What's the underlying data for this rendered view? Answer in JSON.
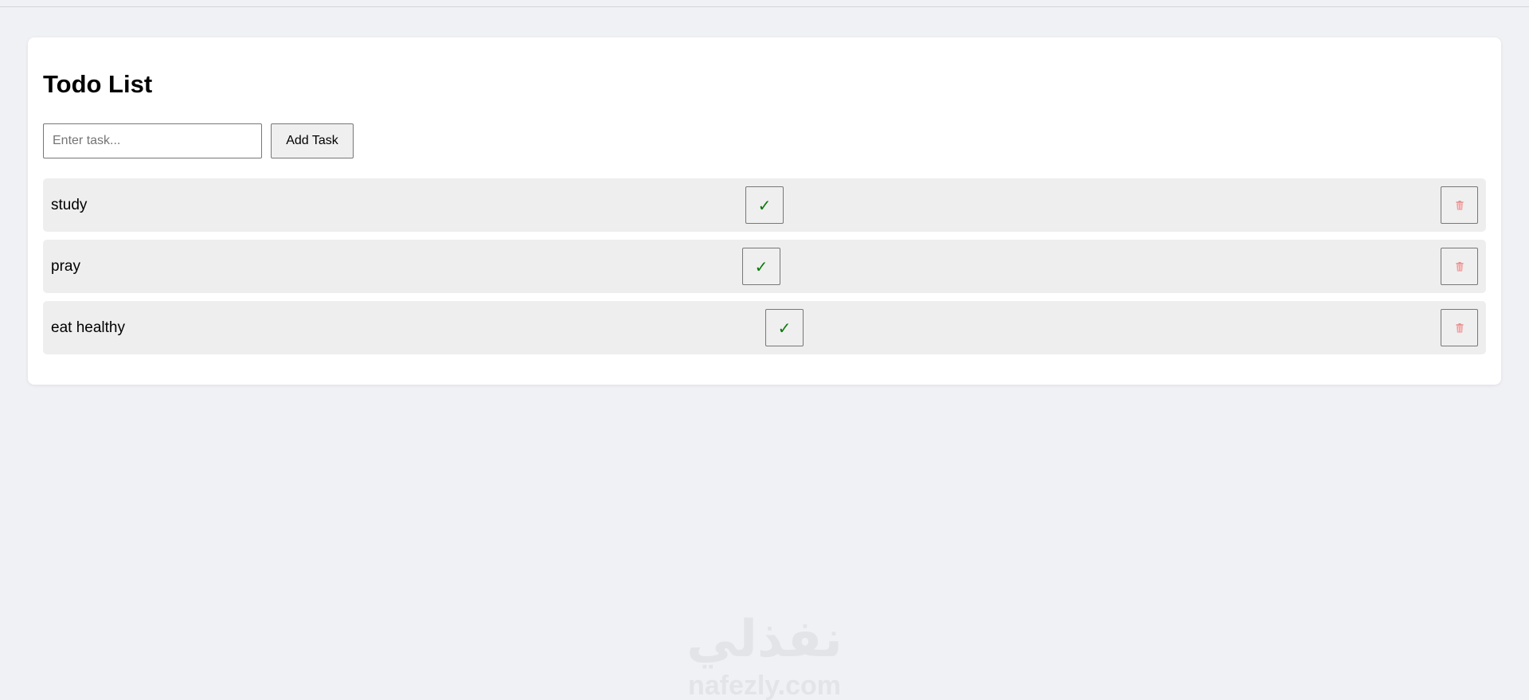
{
  "app": {
    "title": "Todo List"
  },
  "input": {
    "placeholder": "Enter task...",
    "value": ""
  },
  "add_button": {
    "label": "Add Task"
  },
  "tasks": [
    {
      "text": "study",
      "done_icon": "checkmark-icon",
      "delete_icon": "trash-icon"
    },
    {
      "text": "pray",
      "done_icon": "checkmark-icon",
      "delete_icon": "trash-icon"
    },
    {
      "text": "eat healthy",
      "done_icon": "checkmark-icon",
      "delete_icon": "trash-icon"
    }
  ],
  "icons": {
    "check_glyph": "✓"
  },
  "colors": {
    "page_background": "#f0f1f5",
    "card_background": "#ffffff",
    "task_row_background": "#eeeeee",
    "check_color": "#0a7a0a",
    "trash_color": "#e88a8a"
  },
  "watermark": {
    "arabic_text": "نفذلي",
    "latin_text": "nafezly.com"
  }
}
